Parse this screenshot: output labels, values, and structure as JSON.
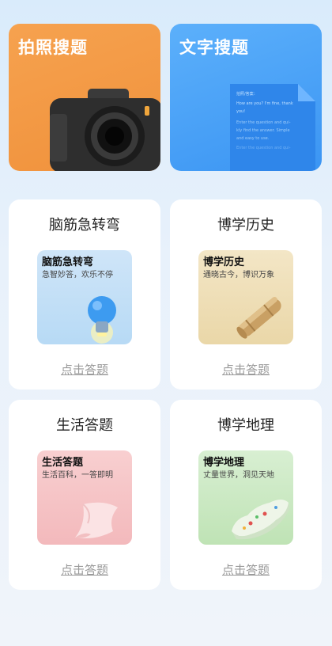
{
  "top": {
    "photo_search": {
      "title": "拍照搜题"
    },
    "text_search": {
      "title": "文字搜题",
      "doc_lines": [
        "拍照/答案：",
        "How are you? I'm fine, thank",
        "you!",
        "Enter the question and qui-",
        "kly find the answer. Simple",
        "and easy to use.",
        "Enter the question and qui-"
      ]
    }
  },
  "cards": [
    {
      "title": "脑筋急转弯",
      "thumb_title": "脑筋急转弯",
      "thumb_sub": "急智妙答，欢乐不停",
      "link": "点击答题"
    },
    {
      "title": "博学历史",
      "thumb_title": "博学历史",
      "thumb_sub": "通晓古今，博识万象",
      "link": "点击答题"
    },
    {
      "title": "生活答题",
      "thumb_title": "生活答题",
      "thumb_sub": "生活百科，一答即明",
      "link": "点击答题"
    },
    {
      "title": "博学地理",
      "thumb_title": "博学地理",
      "thumb_sub": "丈量世界，洞见天地",
      "link": "点击答题"
    }
  ]
}
